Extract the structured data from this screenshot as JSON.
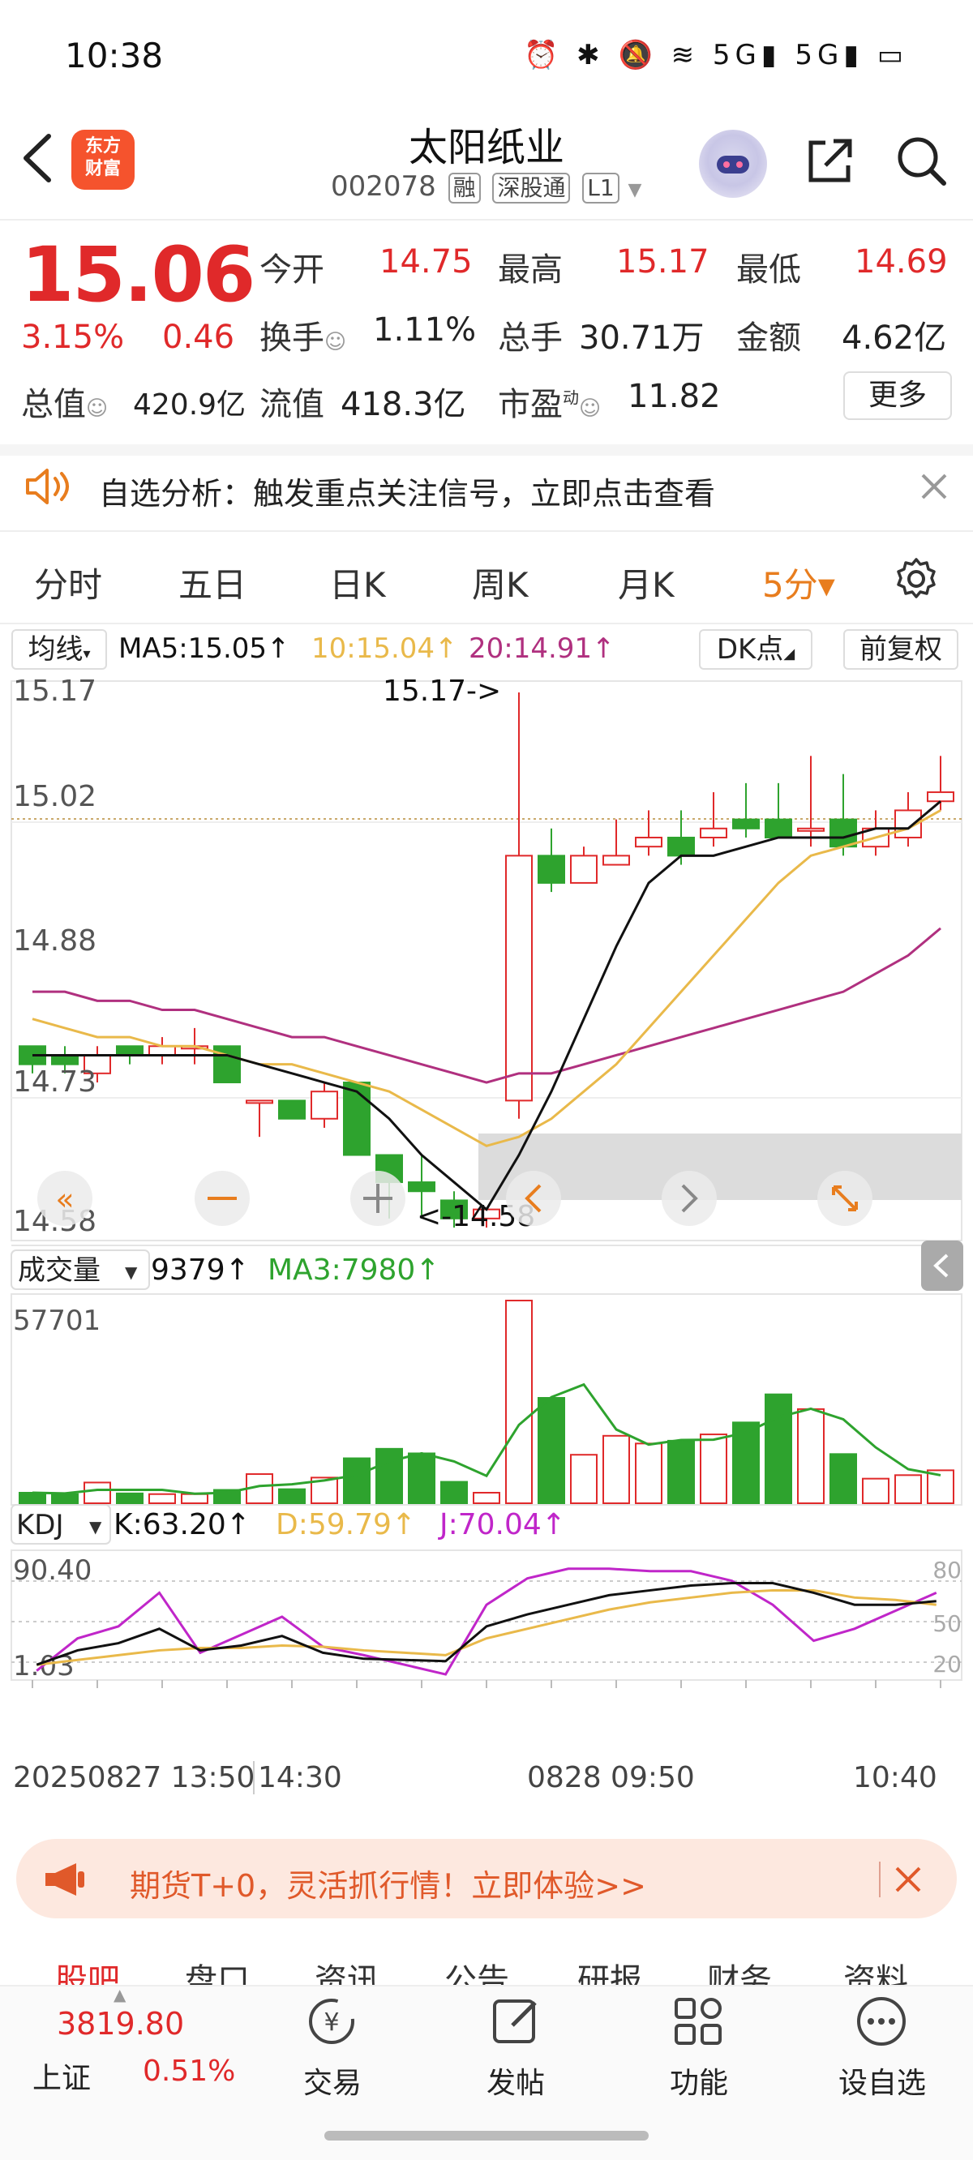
{
  "status_bar": {
    "time": "10:38",
    "icons": "⏰ ✱ 🔕 ≋ 5G▮ 5G▮ ▭"
  },
  "header": {
    "logo_text": "东方财富",
    "stock_name": "太阳纸业",
    "stock_code": "002078",
    "tags": [
      "融",
      "深股通",
      "L1"
    ]
  },
  "quote": {
    "price": "15.06",
    "change_pct": "3.15%",
    "change": "0.46",
    "open_label": "今开",
    "open": "14.75",
    "high_label": "最高",
    "high": "15.17",
    "low_label": "最低",
    "low": "14.69",
    "turnover_label": "换手",
    "turnover": "1.11%",
    "volume_label": "总手",
    "volume": "30.71万",
    "amount_label": "金额",
    "amount": "4.62亿",
    "mktcap_label": "总值",
    "mktcap": "420.9亿",
    "float_label": "流值",
    "float": "418.3亿",
    "pe_label": "市盈",
    "pe_sup": "动",
    "pe": "11.82",
    "more_label": "更多"
  },
  "alert": {
    "text": "自选分析：触发重点关注信号，立即点击查看"
  },
  "tabs": [
    "分时",
    "五日",
    "日K",
    "周K",
    "月K",
    "5分▾"
  ],
  "chart": {
    "ma_btn": "均线",
    "ma5": "MA5:15.05↑",
    "ma10": "10:15.04↑",
    "ma20": "20:14.91↑",
    "dk_btn": "DK点",
    "adj_btn": "前复权",
    "y_labels": [
      "15.17",
      "15.02",
      "14.88",
      "14.73",
      "14.58"
    ],
    "high_marker": "15.17->",
    "low_marker": "<-14.58",
    "vol_btn": "成交量",
    "vol_val": "9379↑",
    "vol_ma3": "MA3:7980↑",
    "vol_max": "57701",
    "kdj_btn": "KDJ",
    "k": "K:63.20↑",
    "d": "D:59.79↑",
    "j": "J:70.04↑",
    "kdj_top": "90.40",
    "kdj_bot": "1.03",
    "kdj_levels": [
      "80",
      "50",
      "20"
    ],
    "x_labels": [
      "20250827 13:50",
      "14:30",
      "0828 09:50",
      "10:40"
    ]
  },
  "chart_data": {
    "type": "candlestick",
    "candles": [
      {
        "o": 14.78,
        "c": 14.76,
        "h": 14.78,
        "l": 14.75
      },
      {
        "o": 14.77,
        "c": 14.76,
        "h": 14.78,
        "l": 14.75
      },
      {
        "o": 14.75,
        "c": 14.77,
        "h": 14.78,
        "l": 14.74
      },
      {
        "o": 14.78,
        "c": 14.77,
        "h": 14.78,
        "l": 14.76
      },
      {
        "o": 14.77,
        "c": 14.78,
        "h": 14.79,
        "l": 14.76
      },
      {
        "o": 14.78,
        "c": 14.78,
        "h": 14.8,
        "l": 14.76
      },
      {
        "o": 14.78,
        "c": 14.74,
        "h": 14.78,
        "l": 14.74
      },
      {
        "o": 14.72,
        "c": 14.72,
        "h": 14.72,
        "l": 14.68
      },
      {
        "o": 14.72,
        "c": 14.7,
        "h": 14.72,
        "l": 14.7
      },
      {
        "o": 14.7,
        "c": 14.73,
        "h": 14.74,
        "l": 14.69
      },
      {
        "o": 14.74,
        "c": 14.66,
        "h": 14.74,
        "l": 14.66
      },
      {
        "o": 14.66,
        "c": 14.63,
        "h": 14.66,
        "l": 14.59
      },
      {
        "o": 14.63,
        "c": 14.62,
        "h": 14.66,
        "l": 14.59
      },
      {
        "o": 14.61,
        "c": 14.59,
        "h": 14.62,
        "l": 14.58
      },
      {
        "o": 14.59,
        "c": 14.6,
        "h": 14.6,
        "l": 14.58
      },
      {
        "o": 14.72,
        "c": 14.99,
        "h": 15.17,
        "l": 14.7
      },
      {
        "o": 14.99,
        "c": 14.96,
        "h": 15.02,
        "l": 14.95
      },
      {
        "o": 14.96,
        "c": 14.99,
        "h": 15.0,
        "l": 14.96
      },
      {
        "o": 14.98,
        "c": 14.99,
        "h": 15.03,
        "l": 14.98
      },
      {
        "o": 15.0,
        "c": 15.01,
        "h": 15.04,
        "l": 14.99
      },
      {
        "o": 15.01,
        "c": 14.99,
        "h": 15.04,
        "l": 14.98
      },
      {
        "o": 15.01,
        "c": 15.02,
        "h": 15.06,
        "l": 15.0
      },
      {
        "o": 15.03,
        "c": 15.02,
        "h": 15.07,
        "l": 15.01
      },
      {
        "o": 15.03,
        "c": 15.01,
        "h": 15.07,
        "l": 15.01
      },
      {
        "o": 15.02,
        "c": 15.02,
        "h": 15.1,
        "l": 15.0
      },
      {
        "o": 15.03,
        "c": 15.0,
        "h": 15.08,
        "l": 14.99
      },
      {
        "o": 15.0,
        "c": 15.02,
        "h": 15.04,
        "l": 14.99
      },
      {
        "o": 15.01,
        "c": 15.04,
        "h": 15.06,
        "l": 15.0
      },
      {
        "o": 15.05,
        "c": 15.06,
        "h": 15.1,
        "l": 15.04
      }
    ],
    "ma5": [
      14.77,
      14.77,
      14.77,
      14.77,
      14.77,
      14.77,
      14.77,
      14.76,
      14.75,
      14.74,
      14.73,
      14.7,
      14.66,
      14.63,
      14.6,
      14.66,
      14.73,
      14.81,
      14.89,
      14.96,
      14.99,
      14.99,
      15.0,
      15.01,
      15.01,
      15.01,
      15.02,
      15.02,
      15.05
    ],
    "ma10": [
      14.81,
      14.8,
      14.79,
      14.79,
      14.78,
      14.78,
      14.77,
      14.76,
      14.76,
      14.75,
      14.74,
      14.73,
      14.71,
      14.69,
      14.67,
      14.68,
      14.7,
      14.73,
      14.76,
      14.8,
      14.84,
      14.88,
      14.92,
      14.96,
      14.99,
      15.0,
      15.01,
      15.02,
      15.04
    ],
    "ma20": [
      14.84,
      14.84,
      14.83,
      14.83,
      14.82,
      14.82,
      14.81,
      14.8,
      14.79,
      14.79,
      14.78,
      14.77,
      14.76,
      14.75,
      14.74,
      14.75,
      14.75,
      14.76,
      14.77,
      14.78,
      14.79,
      14.8,
      14.81,
      14.82,
      14.83,
      14.84,
      14.86,
      14.88,
      14.91
    ],
    "volume": [
      3000,
      2600,
      5900,
      2800,
      2600,
      2600,
      3800,
      8300,
      4000,
      7300,
      12800,
      15500,
      14200,
      6100,
      3000,
      57701,
      30000,
      13800,
      19200,
      17000,
      17800,
      19600,
      23000,
      31000,
      26800,
      14000,
      7000,
      8000,
      9379
    ],
    "vol_ma3": [
      3000,
      2800,
      3800,
      3800,
      3800,
      2700,
      3000,
      4900,
      5400,
      6500,
      8000,
      11900,
      14200,
      11900,
      7800,
      22300,
      30200,
      33800,
      21000,
      16700,
      18000,
      18100,
      20100,
      24500,
      26900,
      23900,
      15900,
      9700,
      7980
    ],
    "kdj_k": [
      10,
      22,
      28,
      40,
      22,
      26,
      34,
      20,
      15,
      14,
      13,
      42,
      52,
      60,
      68,
      72,
      76,
      78,
      78,
      70,
      60,
      60,
      63
    ],
    "kdj_d": [
      10,
      14,
      18,
      22,
      24,
      24,
      26,
      25,
      22,
      20,
      18,
      32,
      40,
      48,
      56,
      62,
      66,
      70,
      72,
      72,
      66,
      64,
      60
    ],
    "kdj_j": [
      5,
      32,
      42,
      70,
      20,
      35,
      50,
      25,
      18,
      10,
      2,
      60,
      82,
      90,
      90,
      88,
      88,
      80,
      60,
      30,
      40,
      55,
      70
    ],
    "y_range": [
      14.58,
      15.17
    ],
    "kdj_range": [
      1.03,
      90.4
    ]
  },
  "banner": {
    "text": "期货T+0，灵活抓行情！立即体验>>"
  },
  "bottom_tabs": [
    "股吧",
    "盘口",
    "资讯",
    "公告",
    "研报",
    "财务",
    "资料"
  ],
  "index": {
    "value": "3819.80",
    "name": "上证",
    "change": "0.51%"
  },
  "nav": [
    "交易",
    "发帖",
    "功能",
    "设自选"
  ],
  "colors": {
    "up": "#e0292a",
    "down": "#2ea32e",
    "ma5": "#111111",
    "ma10": "#e9b94a",
    "ma20": "#b0307f",
    "accent": "#e87d1e"
  }
}
